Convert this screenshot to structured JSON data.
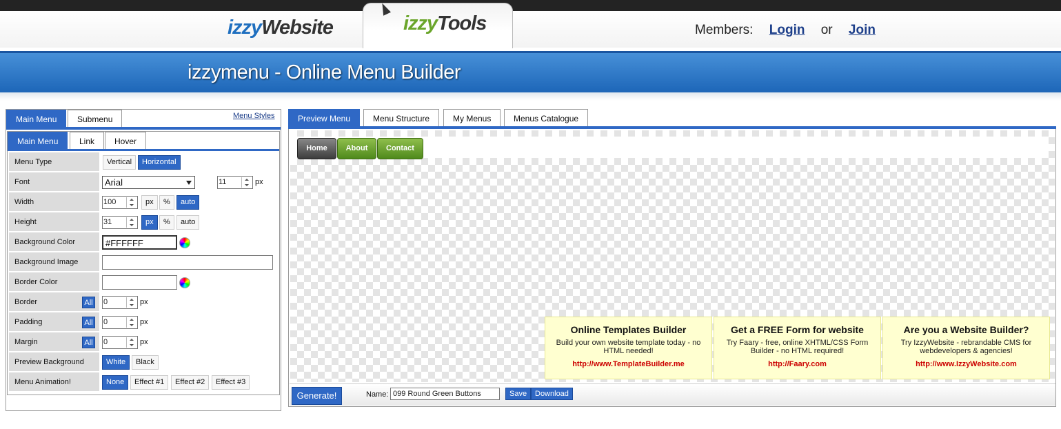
{
  "header": {
    "logo_website_a": "izzy",
    "logo_website_b": "Website",
    "logo_tools_a": "izzy",
    "logo_tools_b": "Tools",
    "members_label": "Members:",
    "login": "Login",
    "or": "or",
    "join": "Join"
  },
  "banner": {
    "title": "izzymenu - Online Menu Builder"
  },
  "left": {
    "tabs": [
      "Main Menu",
      "Submenu"
    ],
    "menu_styles": "Menu Styles",
    "inner_tabs": [
      "Main Menu",
      "Link",
      "Hover"
    ],
    "rows": {
      "menu_type": {
        "label": "Menu Type",
        "options": [
          "Vertical",
          "Horizontal"
        ],
        "selected": "Horizontal"
      },
      "font": {
        "label": "Font",
        "value": "Arial",
        "size": "11",
        "unit": "px"
      },
      "width": {
        "label": "Width",
        "value": "100",
        "units": [
          "px",
          "%",
          "auto"
        ],
        "selected": "auto"
      },
      "height": {
        "label": "Height",
        "value": "31",
        "units": [
          "px",
          "%",
          "auto"
        ],
        "selected": "px"
      },
      "bg_color": {
        "label": "Background Color",
        "value": "#FFFFFF"
      },
      "bg_image": {
        "label": "Background Image",
        "value": ""
      },
      "border_color": {
        "label": "Border Color",
        "value": ""
      },
      "border": {
        "label": "Border",
        "all": "All",
        "value": "0",
        "unit": "px"
      },
      "padding": {
        "label": "Padding",
        "all": "All",
        "value": "0",
        "unit": "px"
      },
      "margin": {
        "label": "Margin",
        "all": "All",
        "value": "0",
        "unit": "px"
      },
      "preview_bg": {
        "label": "Preview Background",
        "options": [
          "White",
          "Black"
        ],
        "selected": "White"
      },
      "animation": {
        "label": "Menu Animation!",
        "options": [
          "None",
          "Effect #1",
          "Effect #2",
          "Effect #3"
        ],
        "selected": "None"
      }
    }
  },
  "right": {
    "tabs": [
      "Preview Menu",
      "Menu Structure",
      "My Menus",
      "Menus Catalogue"
    ],
    "menu_items": [
      "Home",
      "About",
      "Contact"
    ],
    "ads": [
      {
        "title": "Online Templates Builder",
        "text": "Build your own website template today - no HTML needed!",
        "link": "http://www.TemplateBuilder.me"
      },
      {
        "title": "Get a FREE Form for website",
        "text": "Try Faary - free, online XHTML/CSS Form Builder - no HTML required!",
        "link": "http://Faary.com"
      },
      {
        "title": "Are you a Website Builder?",
        "text": "Try IzzyWebsite - rebrandable CMS for webdevelopers & agencies!",
        "link": "http://www.IzzyWebsite.com"
      }
    ],
    "bottom": {
      "generate": "Generate!",
      "name_label": "Name:",
      "name_value": "099 Round Green Buttons",
      "save": "Save",
      "download": "Download"
    }
  }
}
